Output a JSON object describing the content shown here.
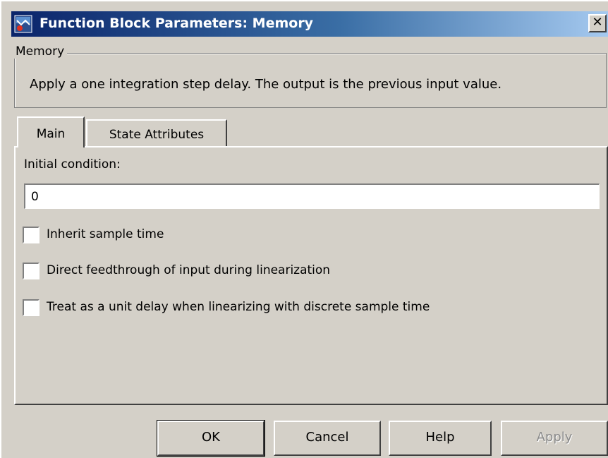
{
  "window": {
    "title": "Function Block Parameters: Memory",
    "close_label": "✕",
    "title_gradient": [
      "#0a246a",
      "#a6caf0"
    ]
  },
  "group": {
    "title": "Memory",
    "description": "Apply a one integration step delay. The output is the previous input value."
  },
  "tabs": [
    {
      "label": "Main",
      "selected": true
    },
    {
      "label": "State Attributes",
      "selected": false
    }
  ],
  "main": {
    "initial_condition_label": "Initial condition:",
    "initial_condition_value": "0",
    "checkboxes": [
      {
        "label": "Inherit sample time",
        "checked": false
      },
      {
        "label": "Direct feedthrough of input during linearization",
        "checked": false
      },
      {
        "label": "Treat as a unit delay when linearizing with discrete sample time",
        "checked": false
      }
    ]
  },
  "buttons": {
    "ok": "OK",
    "cancel": "Cancel",
    "help": "Help",
    "apply": "Apply"
  },
  "icons": {
    "app": "simulink-block-icon",
    "close": "close-icon"
  }
}
